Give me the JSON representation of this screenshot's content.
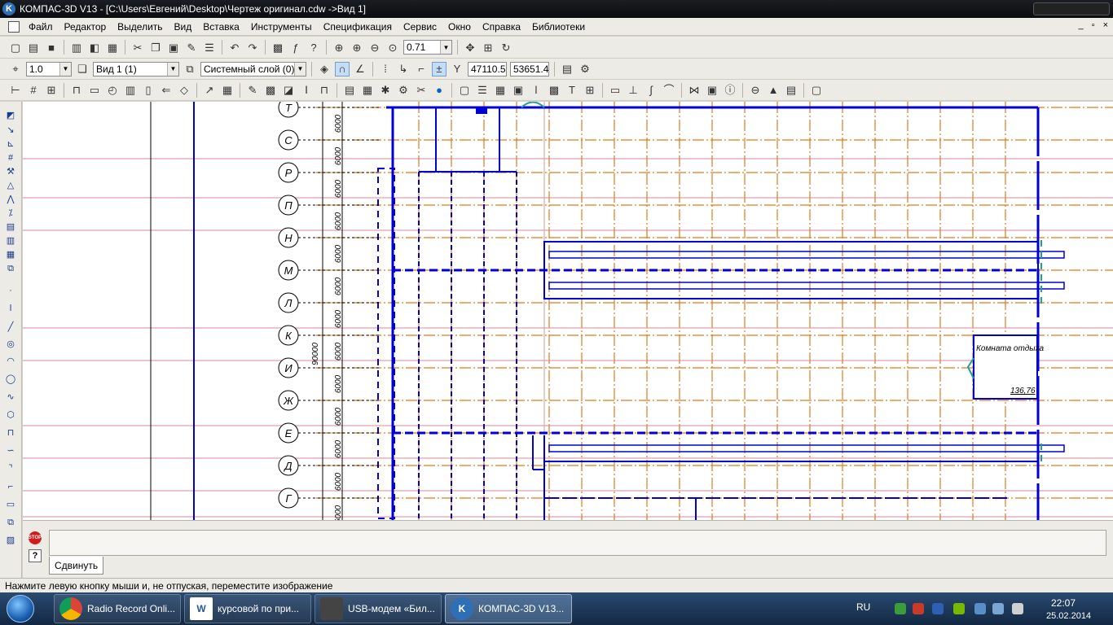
{
  "window": {
    "title": "КОМПАС-3D V13 - [C:\\Users\\Евгений\\Desktop\\Чертеж оригинал.cdw ->Вид 1]",
    "app_logo": "K"
  },
  "menu": {
    "items": [
      "Файл",
      "Редактор",
      "Выделить",
      "Вид",
      "Вставка",
      "Инструменты",
      "Спецификация",
      "Сервис",
      "Окно",
      "Справка",
      "Библиотеки"
    ],
    "mdi_controls": {
      "minimize": "_",
      "restore": "▫",
      "close": "×"
    }
  },
  "toolbar1": {
    "zoom_value": "0.71"
  },
  "toolbar2": {
    "step_value": "1.0",
    "view_value": "Вид 1 (1)",
    "layer_value": "Системный слой (0)",
    "coord_x": "47110.5",
    "coord_y": "53651.4",
    "coord_label": "Y"
  },
  "drawing": {
    "axis_labels": [
      "Т",
      "С",
      "Р",
      "П",
      "Н",
      "М",
      "Л",
      "К",
      "И",
      "Ж",
      "Е",
      "Д",
      "Г"
    ],
    "dimension_label": "6000",
    "total_dimension": "90000",
    "room_label": "Комната отдыха",
    "room_number": "136,76"
  },
  "command_panel": {
    "stop_label": "STOP",
    "help_label": "?",
    "tab_label": "Сдвинуть"
  },
  "status": {
    "text": "Нажмите левую кнопку мыши и, не отпуская, переместите изображение"
  },
  "taskbar": {
    "items": [
      {
        "label": "Radio Record Onli..."
      },
      {
        "label": "курсовой по при..."
      },
      {
        "label": "USB-модем «Бил..."
      },
      {
        "label": "КОМПАС-3D V13..."
      }
    ],
    "tray_lang": "RU",
    "clock_time": "22:07",
    "clock_date": "25.02.2014"
  },
  "colors": {
    "grid_orange": "#e07a1a",
    "wall_blue": "#0000d0",
    "axis_pink": "#d88aa0",
    "teal": "#1aa39a"
  }
}
